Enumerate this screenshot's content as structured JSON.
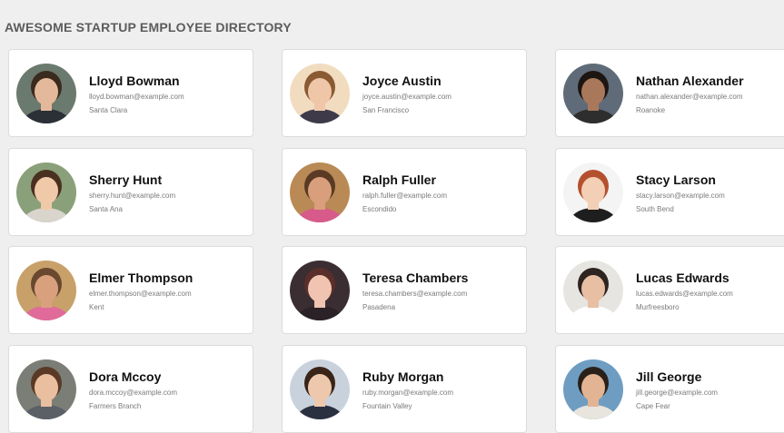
{
  "page": {
    "title": "AWESOME STARTUP EMPLOYEE DIRECTORY"
  },
  "employees": [
    {
      "name": "Lloyd Bowman",
      "email": "lloyd.bowman@example.com",
      "city": "Santa Clara",
      "photo": {
        "bg": "#6b7a6e",
        "skin": "#e4b89a",
        "hair": "#3b2a1e",
        "shirt": "#2b2f36"
      }
    },
    {
      "name": "Joyce Austin",
      "email": "joyce.austin@example.com",
      "city": "San Francisco",
      "photo": {
        "bg": "#f2dcc0",
        "skin": "#efc7a8",
        "hair": "#8a5a32",
        "shirt": "#3f3a4a"
      }
    },
    {
      "name": "Nathan Alexander",
      "email": "nathan.alexander@example.com",
      "city": "Roanoke",
      "photo": {
        "bg": "#5f6b78",
        "skin": "#a9785a",
        "hair": "#1c1512",
        "shirt": "#2e2e2e"
      }
    },
    {
      "name": "Sherry Hunt",
      "email": "sherry.hunt@example.com",
      "city": "Santa Ana",
      "photo": {
        "bg": "#8aa07a",
        "skin": "#f0caa8",
        "hair": "#4a3020",
        "shirt": "#d9d4cc"
      }
    },
    {
      "name": "Ralph Fuller",
      "email": "ralph.fuller@example.com",
      "city": "Escondido",
      "photo": {
        "bg": "#b98a55",
        "skin": "#d99f7c",
        "hair": "#5a3a24",
        "shirt": "#d85a8a"
      }
    },
    {
      "name": "Stacy Larson",
      "email": "stacy.larson@example.com",
      "city": "South Bend",
      "photo": {
        "bg": "#f4f4f4",
        "skin": "#f2cfb5",
        "hair": "#b5502e",
        "shirt": "#1e1e1e"
      }
    },
    {
      "name": "Elmer Thompson",
      "email": "elmer.thompson@example.com",
      "city": "Kent",
      "photo": {
        "bg": "#c8a06a",
        "skin": "#d9a07e",
        "hair": "#6a4830",
        "shirt": "#e06a9a"
      }
    },
    {
      "name": "Teresa Chambers",
      "email": "teresa.chambers@example.com",
      "city": "Pasadena",
      "photo": {
        "bg": "#3a2e32",
        "skin": "#f0c4b0",
        "hair": "#5a2e2a",
        "shirt": "#2a2226"
      }
    },
    {
      "name": "Lucas Edwards",
      "email": "lucas.edwards@example.com",
      "city": "Murfreesboro",
      "photo": {
        "bg": "#e7e5e2",
        "skin": "#e8bfa2",
        "hair": "#2e2420",
        "shirt": "#ffffff"
      }
    },
    {
      "name": "Dora Mccoy",
      "email": "dora.mccoy@example.com",
      "city": "Farmers Branch",
      "photo": {
        "bg": "#7b7e76",
        "skin": "#e9bfa0",
        "hair": "#5a3a26",
        "shirt": "#5b5f66"
      }
    },
    {
      "name": "Ruby Morgan",
      "email": "ruby.morgan@example.com",
      "city": "Fountain Valley",
      "photo": {
        "bg": "#c9d2dc",
        "skin": "#eec8ac",
        "hair": "#3a2418",
        "shirt": "#2a3040"
      }
    },
    {
      "name": "Jill George",
      "email": "jill.george@example.com",
      "city": "Cape Fear",
      "photo": {
        "bg": "#6f9dc2",
        "skin": "#e2b493",
        "hair": "#2a201a",
        "shirt": "#e8e4de"
      }
    }
  ]
}
